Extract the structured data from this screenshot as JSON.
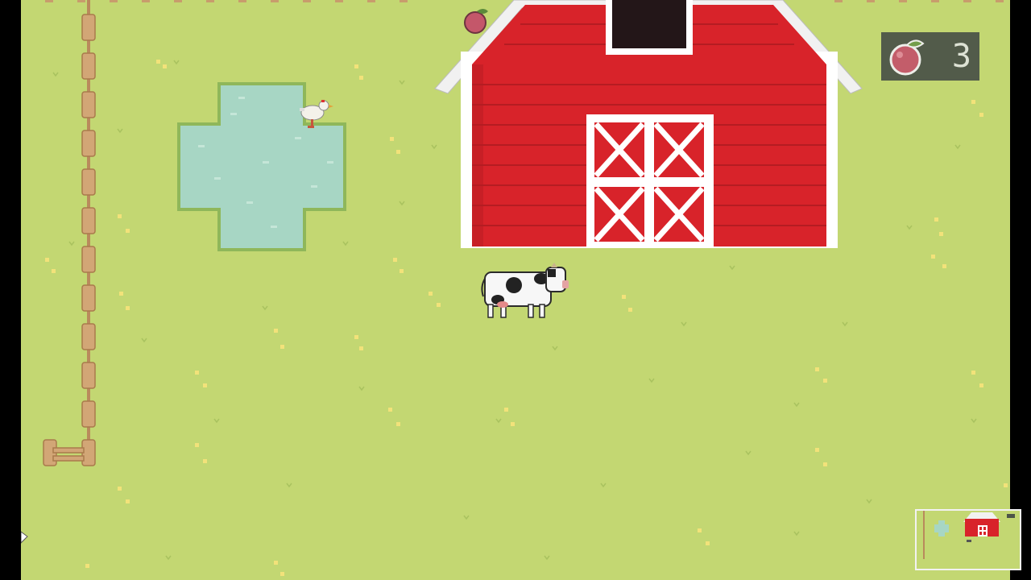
{
  "hud": {
    "apple_count": "3",
    "icon": "apple-icon"
  },
  "colors": {
    "grass": "#c3d772",
    "pond": "#a7d6c4",
    "barn_red": "#d8232a",
    "barn_trim": "#ffffff",
    "fence": "#c89c6c"
  },
  "minimap": {
    "icon": "minimap"
  }
}
